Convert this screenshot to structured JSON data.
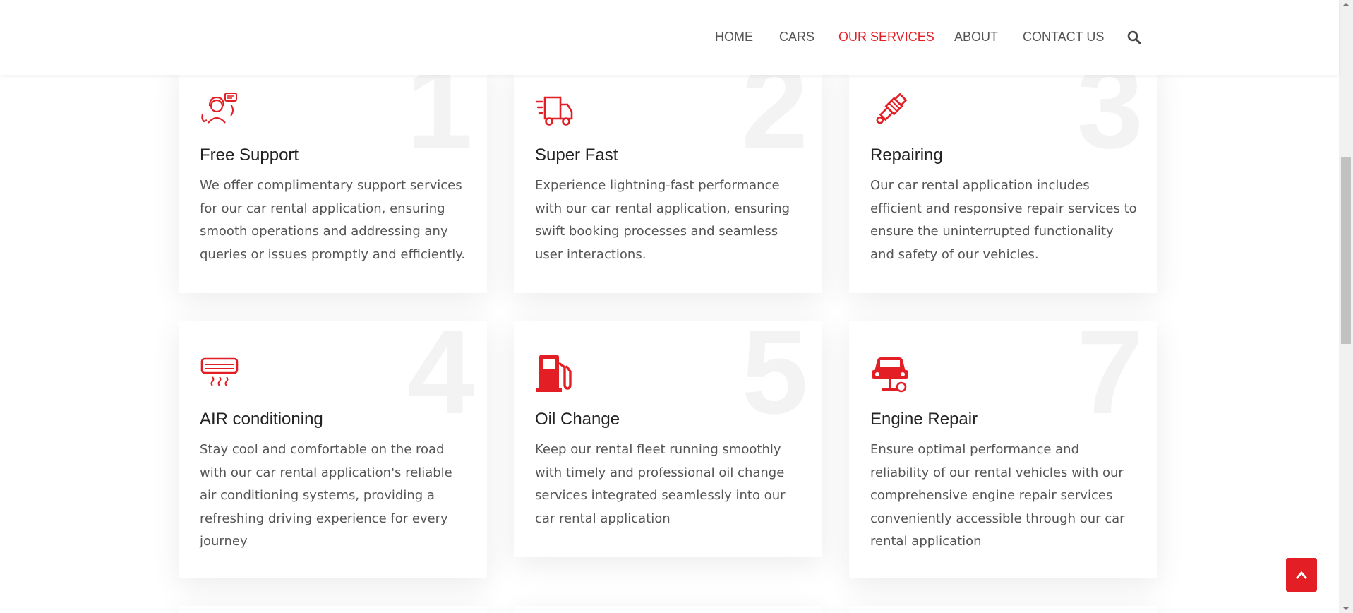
{
  "nav": {
    "items": [
      {
        "label": "HOME",
        "active": false
      },
      {
        "label": "CARS",
        "active": false
      },
      {
        "label": "OUR SERVICES",
        "active": true
      },
      {
        "label": "ABOUT",
        "active": false
      },
      {
        "label": "CONTACT US",
        "active": false
      }
    ],
    "search_icon": "search-icon"
  },
  "colors": {
    "accent": "#e31e24",
    "number_watermark": "#f3f3f3"
  },
  "services": [
    {
      "number": "1",
      "icon": "support-agent-icon",
      "title": "Free Support",
      "description": "We offer complimentary support services for our car rental application, ensuring smooth operations and addressing any queries or issues promptly and efficiently."
    },
    {
      "number": "2",
      "icon": "fast-truck-icon",
      "title": "Super Fast",
      "description": "Experience lightning-fast performance with our car rental application, ensuring swift booking processes and seamless user interactions."
    },
    {
      "number": "3",
      "icon": "spark-plug-icon",
      "title": "Repairing",
      "description": "Our car rental application includes efficient and responsive repair services to ensure the uninterrupted functionality and safety of our vehicles."
    },
    {
      "number": "4",
      "icon": "air-conditioner-icon",
      "title": "AIR conditioning",
      "description": "Stay cool and comfortable on the road with our car rental application's reliable air conditioning systems, providing a refreshing driving experience for every journey"
    },
    {
      "number": "5",
      "icon": "fuel-pump-icon",
      "title": "Oil Change",
      "description": "Keep our rental fleet running smoothly with timely and professional oil change services integrated seamlessly into our car rental application"
    },
    {
      "number": "7",
      "icon": "car-lift-icon",
      "title": "Engine Repair",
      "description": "Ensure optimal performance and reliability of our rental vehicles with our comprehensive engine repair services conveniently accessible through our car rental application"
    }
  ],
  "scroll_to_top_icon": "chevron-up-icon"
}
